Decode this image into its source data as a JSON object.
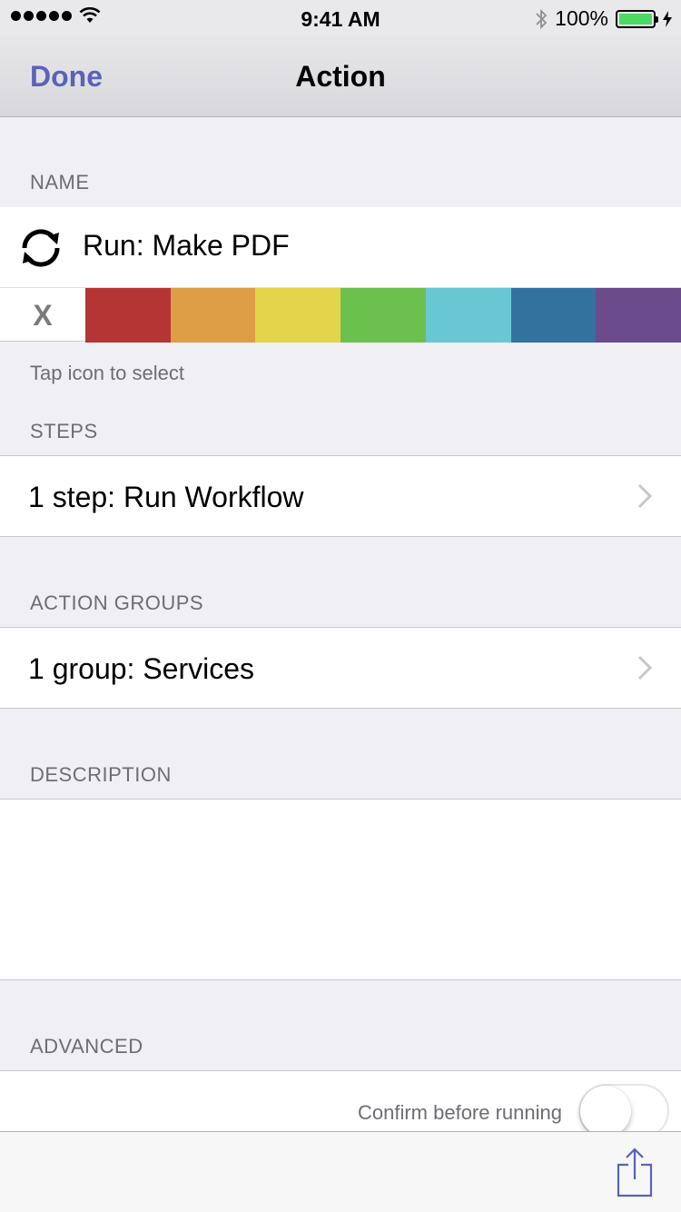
{
  "status_bar": {
    "time": "9:41 AM",
    "battery": "100%",
    "icons": [
      "signal-dots-icon",
      "wifi-icon",
      "bluetooth-icon",
      "battery-icon",
      "charging-bolt-icon"
    ]
  },
  "nav": {
    "done_label": "Done",
    "title": "Action"
  },
  "name_section": {
    "header": "NAME",
    "icon": "sync-icon",
    "name": "Run: Make PDF",
    "clear_label": "X",
    "colors": [
      "#b53535",
      "#dd9e46",
      "#e4d44c",
      "#6cc04d",
      "#69c7d3",
      "#33729e",
      "#6b4b8b"
    ],
    "footer": "Tap icon to select"
  },
  "steps_section": {
    "header": "STEPS",
    "row_label": "1 step: Run Workflow"
  },
  "groups_section": {
    "header": "ACTION GROUPS",
    "row_label": "1 group: Services"
  },
  "description_section": {
    "header": "DESCRIPTION",
    "text": ""
  },
  "advanced_section": {
    "header": "ADVANCED",
    "confirm_label": "Confirm before running",
    "confirm_on": false
  },
  "toolbar": {
    "share_icon": "share-icon"
  },
  "accent_color": "#5b62b8"
}
